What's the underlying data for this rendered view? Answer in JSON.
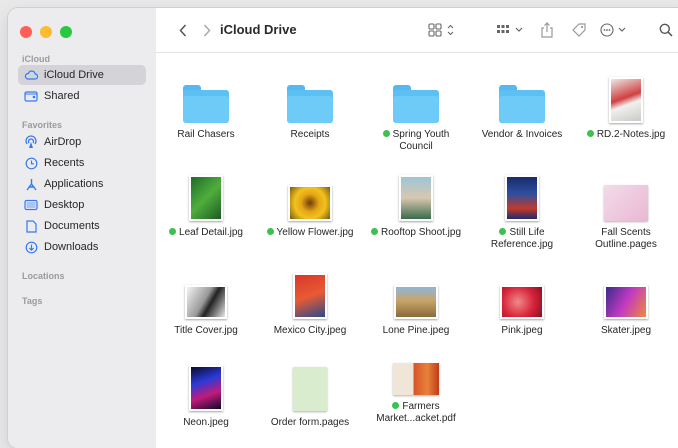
{
  "window": {
    "title": "iCloud Drive"
  },
  "colors": {
    "tag_green": "#3cc151",
    "folder_blue": "#5cc0f4",
    "selected_bg": "#d4d4d8"
  },
  "sidebar": {
    "sections": {
      "icloud": "iCloud",
      "favorites": "Favorites",
      "locations": "Locations",
      "tags": "Tags"
    },
    "items": [
      {
        "label": "iCloud Drive",
        "icon": "cloud-icon",
        "selected": true
      },
      {
        "label": "Shared",
        "icon": "shared-folder-icon"
      },
      {
        "label": "AirDrop",
        "icon": "airdrop-icon"
      },
      {
        "label": "Recents",
        "icon": "clock-icon"
      },
      {
        "label": "Applications",
        "icon": "applications-icon"
      },
      {
        "label": "Desktop",
        "icon": "desktop-icon"
      },
      {
        "label": "Documents",
        "icon": "document-icon"
      },
      {
        "label": "Downloads",
        "icon": "download-icon"
      }
    ]
  },
  "toolbar": {
    "back_icon": "chevron-left-icon",
    "forward_icon": "chevron-right-icon",
    "view_icon": "grid-view-icon",
    "group_icon": "group-icon",
    "share_icon": "share-icon",
    "tag_icon": "tag-icon",
    "more_icon": "ellipsis-icon",
    "search_icon": "search-icon"
  },
  "files": [
    {
      "name": "Rail Chasers",
      "kind": "folder"
    },
    {
      "name": "Receipts",
      "kind": "folder"
    },
    {
      "name": "Spring Youth Council",
      "kind": "folder",
      "tagged": true
    },
    {
      "name": "Vendor & Invoices",
      "kind": "folder"
    },
    {
      "name": "RD.2-Notes.jpg",
      "kind": "image",
      "tagged": true
    },
    {
      "name": "Leaf Detail.jpg",
      "kind": "image",
      "tagged": true
    },
    {
      "name": "Yellow Flower.jpg",
      "kind": "image",
      "tagged": true
    },
    {
      "name": "Rooftop Shoot.jpg",
      "kind": "image",
      "tagged": true
    },
    {
      "name": "Still Life Reference.jpg",
      "kind": "image",
      "tagged": true
    },
    {
      "name": "Fall Scents Outline.pages",
      "kind": "pages"
    },
    {
      "name": "Title Cover.jpg",
      "kind": "image"
    },
    {
      "name": "Mexico City.jpeg",
      "kind": "image"
    },
    {
      "name": "Lone Pine.jpeg",
      "kind": "image"
    },
    {
      "name": "Pink.jpeg",
      "kind": "image"
    },
    {
      "name": "Skater.jpeg",
      "kind": "image"
    },
    {
      "name": "Neon.jpeg",
      "kind": "image"
    },
    {
      "name": "Order form.pages",
      "kind": "pages"
    },
    {
      "name": "Farmers Market...acket.pdf",
      "kind": "pdf",
      "tagged": true
    }
  ]
}
